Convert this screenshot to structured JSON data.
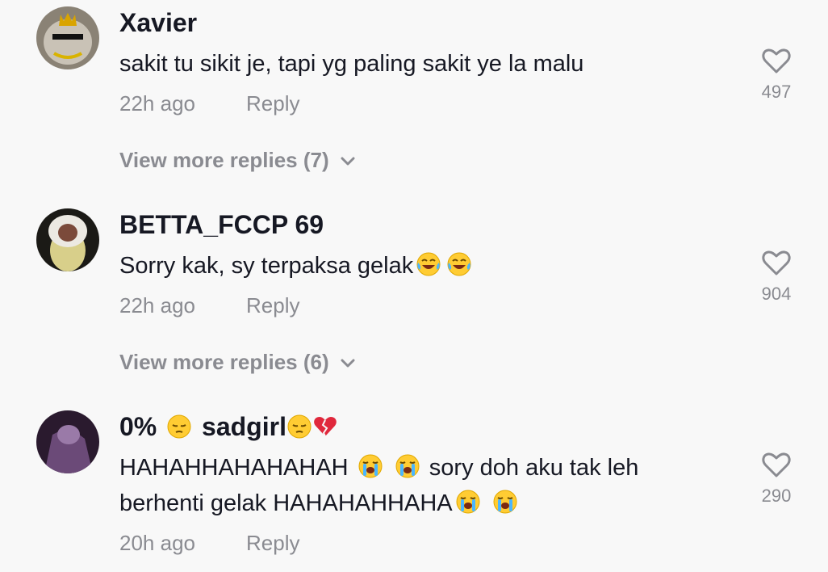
{
  "comments": [
    {
      "username": "Xavier",
      "text": "sakit tu sikit je, tapi yg paling sakit ye la malu",
      "time": "22h ago",
      "reply_label": "Reply",
      "likes": "497",
      "view_more": "View more replies (7)"
    },
    {
      "username": "BETTA_FCCP 69",
      "text": "Sorry kak, sy terpaksa gelak",
      "time": "22h ago",
      "reply_label": "Reply",
      "likes": "904",
      "view_more": "View more replies (6)"
    },
    {
      "username_part1": "0%",
      "username_part2": "sadgirl",
      "text_line1": "HAHAHHAHAHAHAH",
      "text_line1b": "sory doh aku tak leh",
      "text_line2": "berhenti gelak HAHAHAHHAHA",
      "time": "20h ago",
      "reply_label": "Reply",
      "likes": "290"
    }
  ],
  "icons": {
    "like": "heart-outline-icon",
    "expand": "chevron-down-icon",
    "emoji_laugh": "face-with-tears-of-joy",
    "emoji_cry": "loudly-crying-face",
    "emoji_pensive": "pensive-face",
    "emoji_broken_heart": "broken-heart"
  },
  "colors": {
    "background": "#f8f8f8",
    "text_primary": "#161823",
    "text_secondary": "#8a8b91"
  }
}
